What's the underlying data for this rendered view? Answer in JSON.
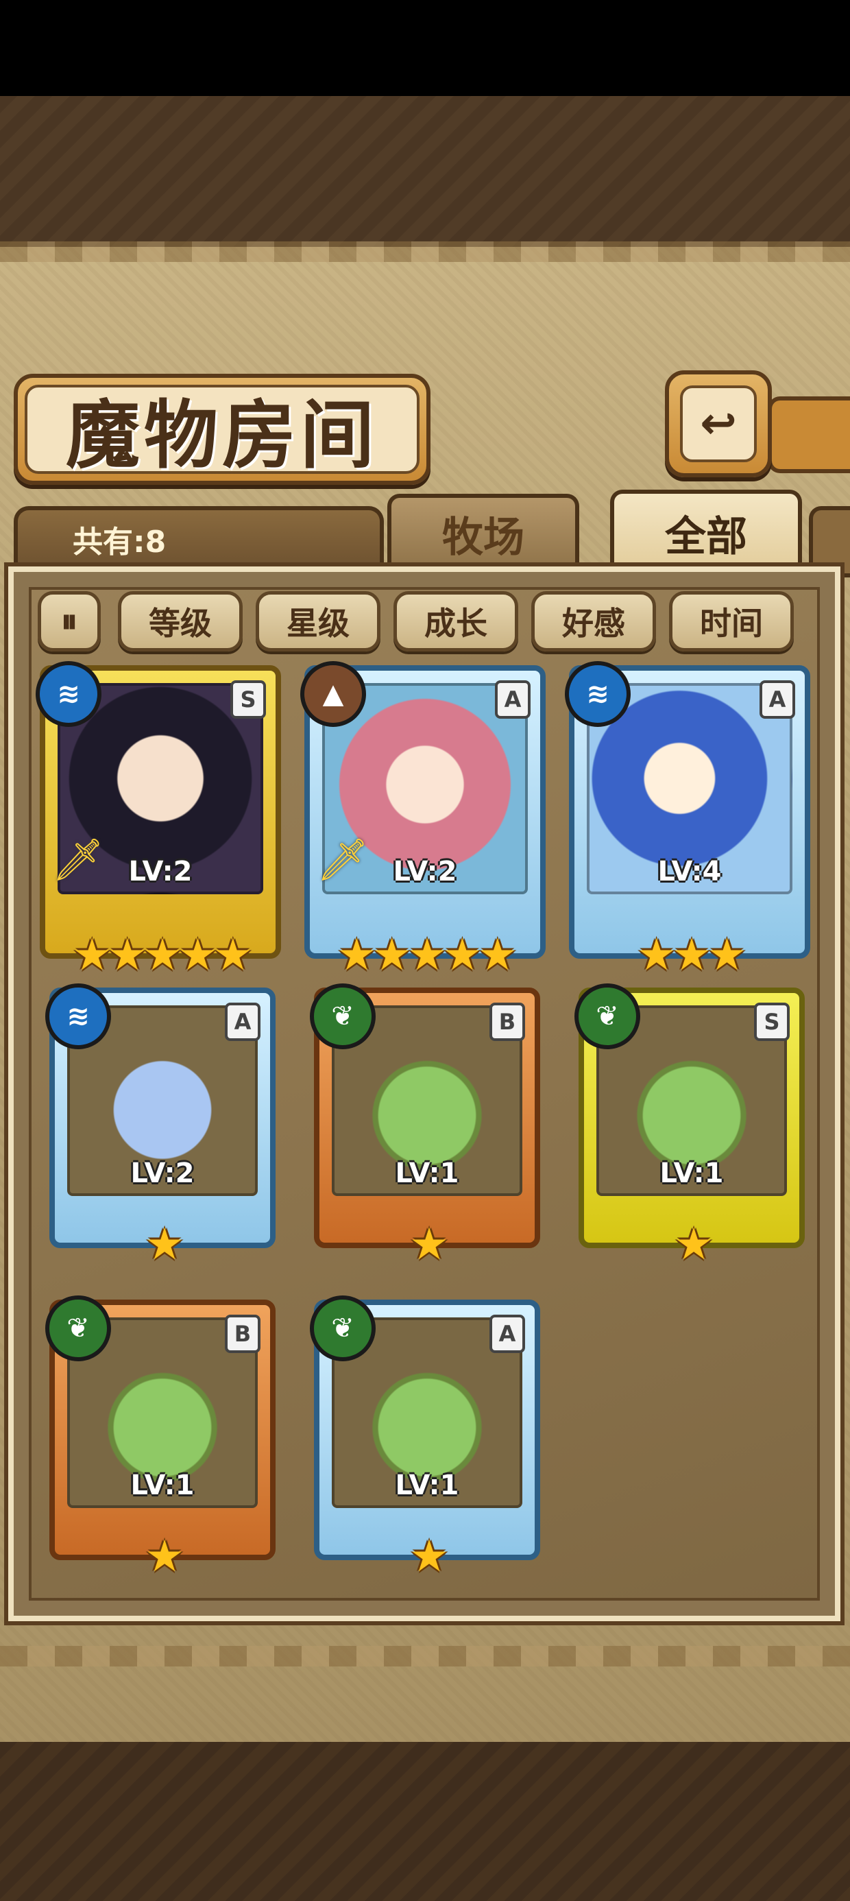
{
  "title": "魔物房间",
  "back_icon": "return-icon",
  "count_label": "共有:8",
  "tabs": [
    {
      "label": "牧场",
      "selected": false
    },
    {
      "label": "全部",
      "selected": true
    }
  ],
  "filter_toggle_icon": "pause-sort-icon",
  "filters": [
    "等级",
    "星级",
    "成长",
    "好感",
    "时间"
  ],
  "monsters": [
    {
      "rank": "S",
      "level": "LV:2",
      "stars": "★★★★★",
      "element": "water-icon",
      "frame": "gold",
      "has_sword": true
    },
    {
      "rank": "A",
      "level": "LV:2",
      "stars": "★★★★★",
      "element": "earth-icon",
      "frame": "blue",
      "has_sword": true
    },
    {
      "rank": "A",
      "level": "LV:4",
      "stars": "★★★",
      "element": "water-icon",
      "frame": "blue",
      "has_sword": false
    },
    {
      "rank": "A",
      "level": "LV:2",
      "stars": "★",
      "element": "water-icon",
      "frame": "blue",
      "has_sword": false
    },
    {
      "rank": "B",
      "level": "LV:1",
      "stars": "★",
      "element": "grass-icon",
      "frame": "orange",
      "has_sword": false
    },
    {
      "rank": "S",
      "level": "LV:1",
      "stars": "★",
      "element": "grass-icon",
      "frame": "yellow",
      "has_sword": false
    },
    {
      "rank": "B",
      "level": "LV:1",
      "stars": "★",
      "element": "grass-icon",
      "frame": "orange",
      "has_sword": false
    },
    {
      "rank": "A",
      "level": "LV:1",
      "stars": "★",
      "element": "grass-icon",
      "frame": "blue",
      "has_sword": false
    }
  ]
}
